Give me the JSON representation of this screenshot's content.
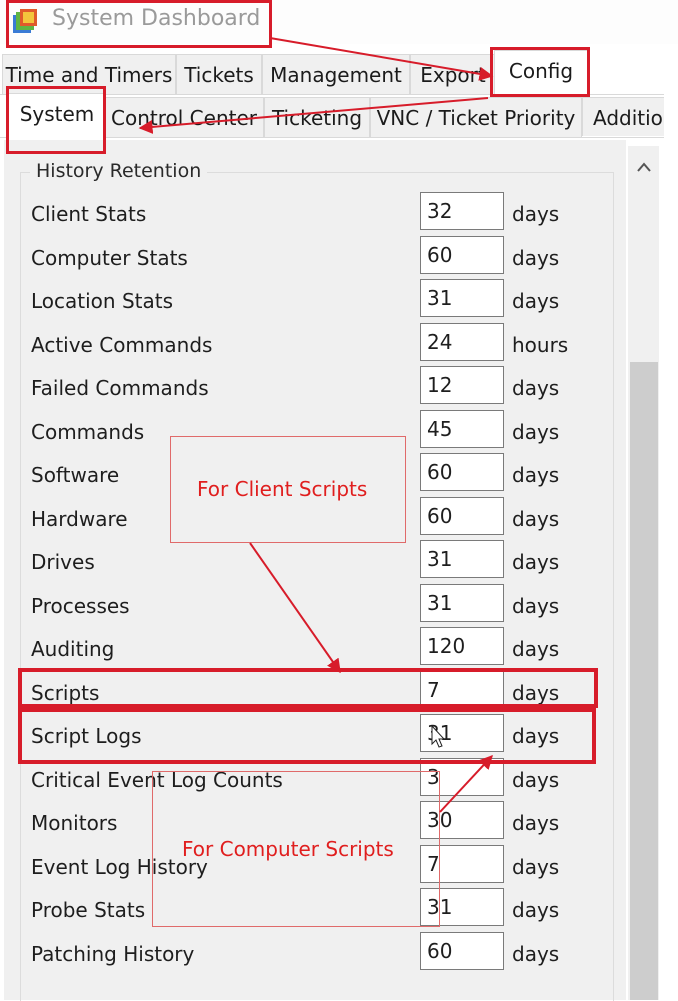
{
  "window": {
    "title": "System Dashboard"
  },
  "outer_tabs": [
    {
      "label": "Time and Timers"
    },
    {
      "label": "Tickets"
    },
    {
      "label": "Management"
    },
    {
      "label": "Export"
    },
    {
      "label": "Config",
      "selected": true
    }
  ],
  "inner_tabs": [
    {
      "label": "System",
      "selected": true
    },
    {
      "label": "Control Center"
    },
    {
      "label": "Ticketing"
    },
    {
      "label": "VNC / Ticket Priority"
    },
    {
      "label": "Additional"
    }
  ],
  "history_retention": {
    "legend": "History Retention",
    "rows": [
      {
        "label": "Client Stats",
        "value": "32",
        "unit": "days"
      },
      {
        "label": "Computer Stats",
        "value": "60",
        "unit": "days"
      },
      {
        "label": "Location Stats",
        "value": "31",
        "unit": "days"
      },
      {
        "label": "Active Commands",
        "value": "24",
        "unit": "hours"
      },
      {
        "label": "Failed Commands",
        "value": "12",
        "unit": "days"
      },
      {
        "label": "Commands",
        "value": "45",
        "unit": "days"
      },
      {
        "label": "Software",
        "value": "60",
        "unit": "days"
      },
      {
        "label": "Hardware",
        "value": "60",
        "unit": "days"
      },
      {
        "label": "Drives",
        "value": "31",
        "unit": "days"
      },
      {
        "label": "Processes",
        "value": "31",
        "unit": "days"
      },
      {
        "label": "Auditing",
        "value": "120",
        "unit": "days"
      },
      {
        "label": "Scripts",
        "value": "7",
        "unit": "days"
      },
      {
        "label": "Script Logs",
        "value": "31",
        "unit": "days"
      },
      {
        "label": "Critical Event Log Counts",
        "value": "3",
        "unit": "days"
      },
      {
        "label": "Monitors",
        "value": "30",
        "unit": "days"
      },
      {
        "label": "Event Log History",
        "value": "7",
        "unit": "days"
      },
      {
        "label": "Probe Stats",
        "value": "31",
        "unit": "days"
      },
      {
        "label": "Patching History",
        "value": "60",
        "unit": "days"
      }
    ]
  },
  "annotations": {
    "client_scripts": "For Client Scripts",
    "computer_scripts": "For Computer Scripts"
  },
  "colors": {
    "annotation_red": "#d71c2a",
    "tab_bg": "#f0f0f0",
    "panel_bg": "#f0f0f0"
  }
}
